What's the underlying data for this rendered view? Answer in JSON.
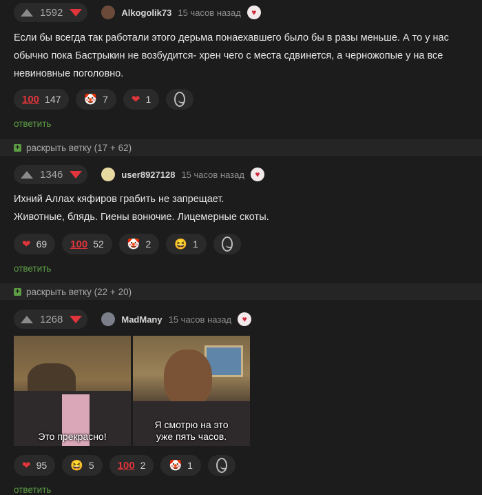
{
  "comments": [
    {
      "rating": "1592",
      "user": "Alkogolik73",
      "time": "15 часов назад",
      "avatar_color": "#6b4a3a",
      "lines": [
        "Если бы всегда так работали этого дерьма понаехавшего было бы в разы меньше. А то у нас",
        "обычно пока Бастрыкин не возбудится- хрен чего с места сдвинется, а черножопые у на все",
        "невиновные поголовно."
      ],
      "reactions": [
        {
          "icon": "hundred-icon",
          "count": "147"
        },
        {
          "icon": "clown-icon",
          "count": "7"
        },
        {
          "icon": "heart-icon",
          "count": "1"
        }
      ],
      "reply": "ответить"
    },
    {
      "rating": "1346",
      "user": "user8927128",
      "time": "15 часов назад",
      "avatar_color": "#e8d9a0",
      "lines": [
        "Ихний Аллах кяфиров грабить не запрещает.",
        "Животные, блядь. Гиены вонючие. Лицемерные скоты."
      ],
      "reactions": [
        {
          "icon": "heart-icon",
          "count": "69"
        },
        {
          "icon": "hundred-icon",
          "count": "52"
        },
        {
          "icon": "clown-icon",
          "count": "2"
        },
        {
          "icon": "laugh-icon",
          "count": "1"
        }
      ],
      "reply": "ответить"
    },
    {
      "rating": "1268",
      "user": "MadMany",
      "time": "15 часов назад",
      "avatar_color": "#7a7f8a",
      "gif_captions": [
        "Это прекрасно!",
        "Я смотрю на это",
        "уже пять часов."
      ],
      "reactions": [
        {
          "icon": "heart-icon",
          "count": "95"
        },
        {
          "icon": "laugh-icon",
          "count": "5"
        },
        {
          "icon": "hundred-icon",
          "count": "2"
        },
        {
          "icon": "clown-icon",
          "count": "1"
        }
      ],
      "reply": "ответить"
    }
  ],
  "expanders": [
    {
      "label": "раскрыть ветку (17 + 62)"
    },
    {
      "label": "раскрыть ветку (22 + 20)"
    }
  ],
  "colors": {
    "accent": "#5d9e44",
    "downvote": "#e0353b",
    "background": "#1c1c1c"
  }
}
